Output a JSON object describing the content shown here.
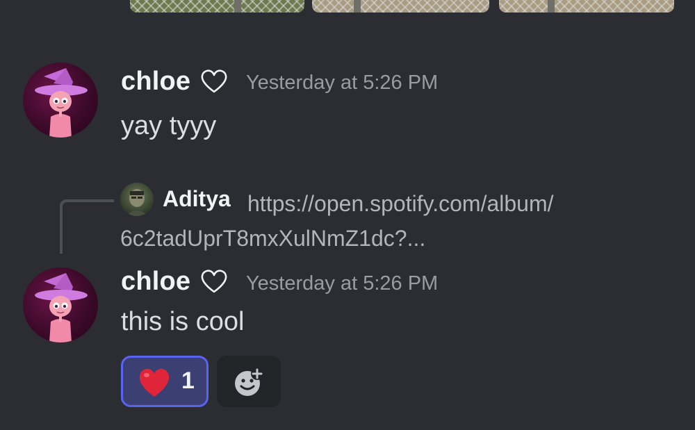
{
  "messages": [
    {
      "author": "chloe",
      "timestamp": "Yesterday at 5:26 PM",
      "text": "yay tyyy"
    },
    {
      "author": "chloe",
      "timestamp": "Yesterday at 5:26 PM",
      "text": "this is cool",
      "reply": {
        "author": "Aditya",
        "text_line1": "https://open.spotify.com/album/",
        "text_line2": "6c2tadUprT8mxXulNmZ1dc?..."
      },
      "reactions": [
        {
          "emoji": "red-heart",
          "count": "1",
          "selected": true
        }
      ]
    }
  ],
  "icons": {
    "name_decoration": "heart-outline-icon",
    "add_reaction": "add-reaction-icon"
  },
  "colors": {
    "background": "#2c2d33",
    "reaction_selected_border": "#5865f2",
    "reaction_selected_bg": "#3b3f72"
  }
}
